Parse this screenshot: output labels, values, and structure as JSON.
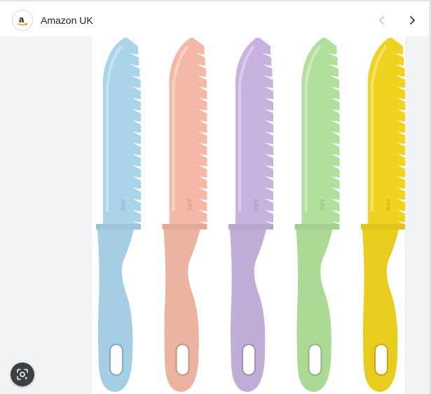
{
  "header": {
    "site_name": "Amazon UK",
    "logo_icon": "amazon-logo-icon",
    "prev_icon": "chevron-left-icon",
    "next_icon": "chevron-right-icon"
  },
  "image": {
    "subject_colors": [
      "#a9d4ea",
      "#f4b9a6",
      "#c7b3df",
      "#b2e09c",
      "#f0d31e"
    ],
    "knife_marking": "AIRE"
  },
  "lens_button": {
    "icon": "visual-search-icon"
  }
}
